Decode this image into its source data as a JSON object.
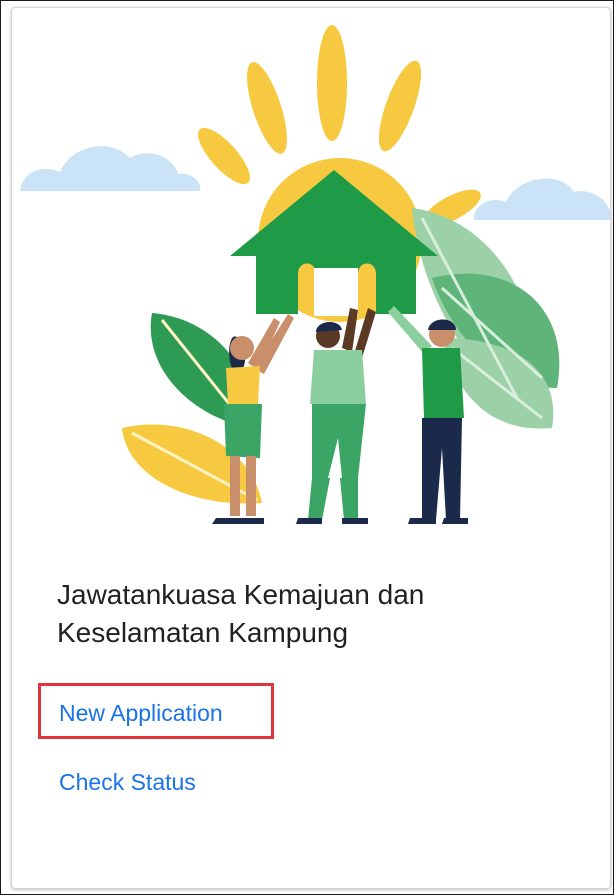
{
  "card": {
    "title": "Jawatankuasa Kemajuan dan Keselamatan Kampung",
    "links": {
      "new_application": "New Application",
      "check_status": "Check Status"
    }
  },
  "colors": {
    "link": "#1a73e8",
    "highlight": "#e0353b",
    "sun": "#f6c940",
    "house": "#1f9a47",
    "cloud": "#cbe3f7"
  },
  "illustration": {
    "icon": "house-sun-people-illustration"
  }
}
